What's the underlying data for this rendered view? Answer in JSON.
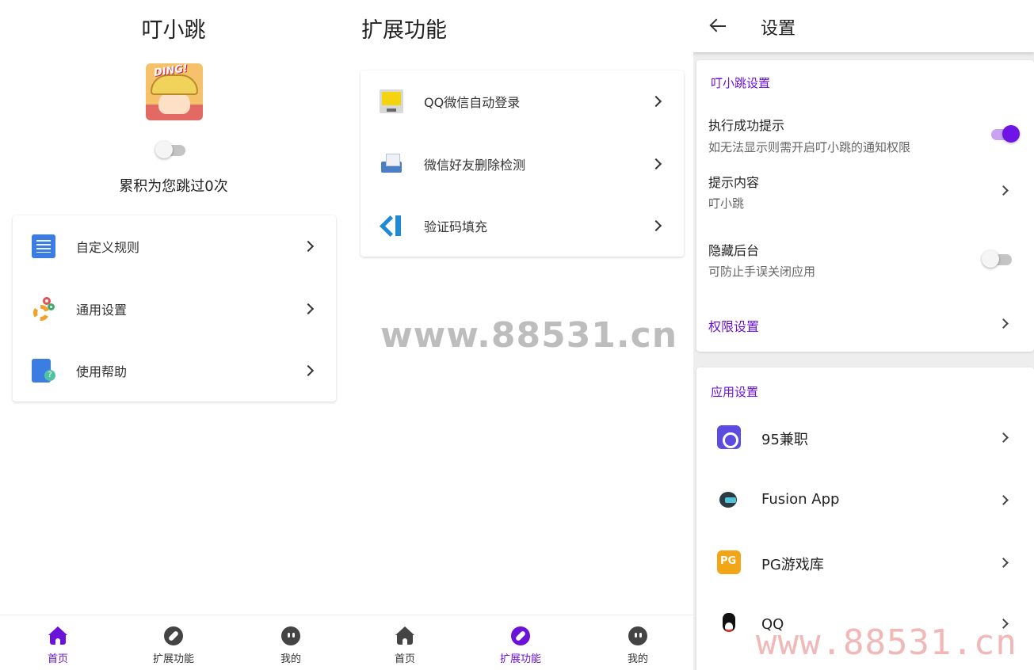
{
  "panel_home": {
    "title": "叮小跳",
    "jump_count_text": "累积为您跳过0次",
    "service_toggle_on": false,
    "menu": [
      {
        "label": "自定义规则",
        "icon": "rule-doc-icon"
      },
      {
        "label": "通用设置",
        "icon": "gears-icon"
      },
      {
        "label": "使用帮助",
        "icon": "help-book-icon"
      }
    ],
    "avatar_text": "DING!"
  },
  "panel_extensions": {
    "title": "扩展功能",
    "menu": [
      {
        "label": "QQ微信自动登录",
        "icon": "monitor-icon"
      },
      {
        "label": "微信好友删除检测",
        "icon": "printer-icon"
      },
      {
        "label": "验证码填充",
        "icon": "vscode-icon"
      }
    ]
  },
  "panel_settings": {
    "title": "设置",
    "section_app": {
      "header": "叮小跳设置",
      "success_hint": {
        "title": "执行成功提示",
        "subtitle": "如无法显示则需开启叮小跳的通知权限",
        "toggle_on": true
      },
      "hint_content": {
        "title": "提示内容",
        "value": "叮小跳"
      },
      "hide_background": {
        "title": "隐藏后台",
        "subtitle": "可防止手误关闭应用",
        "toggle_on": false
      },
      "permissions": {
        "label": "权限设置"
      }
    },
    "section_apps": {
      "header": "应用设置",
      "apps": [
        {
          "label": "95兼职",
          "icon": "app-95-icon"
        },
        {
          "label": "Fusion App",
          "icon": "fusion-app-icon"
        },
        {
          "label": "PG游戏库",
          "icon": "pg-game-icon"
        },
        {
          "label": "QQ",
          "icon": "qq-penguin-icon"
        }
      ]
    }
  },
  "bottom_nav": {
    "items": [
      {
        "label": "首页",
        "icon": "home-icon"
      },
      {
        "label": "扩展功能",
        "icon": "compass-icon"
      },
      {
        "label": "我的",
        "icon": "me-icon"
      }
    ]
  },
  "watermarks": {
    "center": "www.88531.cn",
    "corner": "www.88531.cn"
  },
  "colors": {
    "accent": "#6a12d8",
    "toggle_on_thumb": "#6f14e6",
    "toggle_on_track": "#c9a2f0"
  }
}
